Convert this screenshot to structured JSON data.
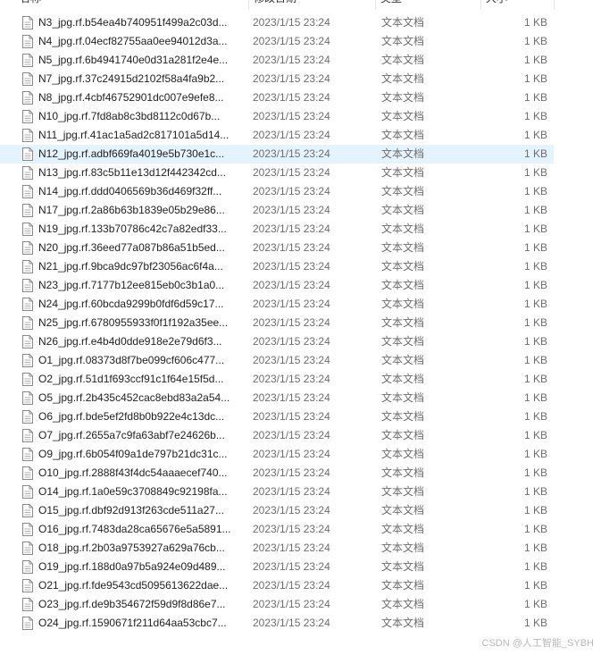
{
  "columns": {
    "name": "名称",
    "modified": "修改日期",
    "type": "类型",
    "size": "大小"
  },
  "icon": "text-document-icon",
  "selected_color": "#e5f3ff",
  "files": [
    {
      "name": "N3_jpg.rf.b54ea4b740951f499a2c03d...",
      "modified": "2023/1/15 23:24",
      "type": "文本文档",
      "size": "1 KB"
    },
    {
      "name": "N4_jpg.rf.04ecf82755aa0ee94012d3a...",
      "modified": "2023/1/15 23:24",
      "type": "文本文档",
      "size": "1 KB"
    },
    {
      "name": "N5_jpg.rf.6b4941740e0d31a281f2e4e...",
      "modified": "2023/1/15 23:24",
      "type": "文本文档",
      "size": "1 KB"
    },
    {
      "name": "N7_jpg.rf.37c24915d2102f58a4fa9b2...",
      "modified": "2023/1/15 23:24",
      "type": "文本文档",
      "size": "1 KB"
    },
    {
      "name": "N8_jpg.rf.4cbf46752901dc007e9efe8...",
      "modified": "2023/1/15 23:24",
      "type": "文本文档",
      "size": "1 KB"
    },
    {
      "name": "N10_jpg.rf.7fd8ab8c3bd8112c0d67b...",
      "modified": "2023/1/15 23:24",
      "type": "文本文档",
      "size": "1 KB"
    },
    {
      "name": "N11_jpg.rf.41ac1a5ad2c817101a5d14...",
      "modified": "2023/1/15 23:24",
      "type": "文本文档",
      "size": "1 KB"
    },
    {
      "name": "N12_jpg.rf.adbf669fa4019e5b730e1c...",
      "modified": "2023/1/15 23:24",
      "type": "文本文档",
      "size": "1 KB",
      "selected": true
    },
    {
      "name": "N13_jpg.rf.83c5b11e13d12f442342cd...",
      "modified": "2023/1/15 23:24",
      "type": "文本文档",
      "size": "1 KB"
    },
    {
      "name": "N14_jpg.rf.ddd0406569b36d469f32ff...",
      "modified": "2023/1/15 23:24",
      "type": "文本文档",
      "size": "1 KB"
    },
    {
      "name": "N17_jpg.rf.2a86b63b1839e05b29e86...",
      "modified": "2023/1/15 23:24",
      "type": "文本文档",
      "size": "1 KB"
    },
    {
      "name": "N19_jpg.rf.133b70786c42c7a82edf33...",
      "modified": "2023/1/15 23:24",
      "type": "文本文档",
      "size": "1 KB"
    },
    {
      "name": "N20_jpg.rf.36eed77a087b86a51b5ed...",
      "modified": "2023/1/15 23:24",
      "type": "文本文档",
      "size": "1 KB"
    },
    {
      "name": "N21_jpg.rf.9bca9dc97bf23056ac6f4a...",
      "modified": "2023/1/15 23:24",
      "type": "文本文档",
      "size": "1 KB"
    },
    {
      "name": "N23_jpg.rf.7177b12ee815eb0c3b1a0...",
      "modified": "2023/1/15 23:24",
      "type": "文本文档",
      "size": "1 KB"
    },
    {
      "name": "N24_jpg.rf.60bcda9299b0fdf6d59c17...",
      "modified": "2023/1/15 23:24",
      "type": "文本文档",
      "size": "1 KB"
    },
    {
      "name": "N25_jpg.rf.6780955933f0f1f192a35ee...",
      "modified": "2023/1/15 23:24",
      "type": "文本文档",
      "size": "1 KB"
    },
    {
      "name": "N26_jpg.rf.e4b4d0dde918e2e79d6f3...",
      "modified": "2023/1/15 23:24",
      "type": "文本文档",
      "size": "1 KB"
    },
    {
      "name": "O1_jpg.rf.08373d8f7be099cf606c477...",
      "modified": "2023/1/15 23:24",
      "type": "文本文档",
      "size": "1 KB"
    },
    {
      "name": "O2_jpg.rf.51d1f693ccf91c1f64e15f5d...",
      "modified": "2023/1/15 23:24",
      "type": "文本文档",
      "size": "1 KB"
    },
    {
      "name": "O5_jpg.rf.2b435c452cac8ebd83a2a54...",
      "modified": "2023/1/15 23:24",
      "type": "文本文档",
      "size": "1 KB"
    },
    {
      "name": "O6_jpg.rf.bde5ef2fd8b0b922e4c13dc...",
      "modified": "2023/1/15 23:24",
      "type": "文本文档",
      "size": "1 KB"
    },
    {
      "name": "O7_jpg.rf.2655a7c9fa63abf7e24626b...",
      "modified": "2023/1/15 23:24",
      "type": "文本文档",
      "size": "1 KB"
    },
    {
      "name": "O9_jpg.rf.6b054f09a1de797b21dc31c...",
      "modified": "2023/1/15 23:24",
      "type": "文本文档",
      "size": "1 KB"
    },
    {
      "name": "O10_jpg.rf.2888f43f4dc54aaaecef740...",
      "modified": "2023/1/15 23:24",
      "type": "文本文档",
      "size": "1 KB"
    },
    {
      "name": "O14_jpg.rf.1a0e59c3708849c92198fa...",
      "modified": "2023/1/15 23:24",
      "type": "文本文档",
      "size": "1 KB"
    },
    {
      "name": "O15_jpg.rf.dbf92d913f263cde511a27...",
      "modified": "2023/1/15 23:24",
      "type": "文本文档",
      "size": "1 KB"
    },
    {
      "name": "O16_jpg.rf.7483da28ca65676e5a5891...",
      "modified": "2023/1/15 23:24",
      "type": "文本文档",
      "size": "1 KB"
    },
    {
      "name": "O18_jpg.rf.2b03a9753927a629a76cb...",
      "modified": "2023/1/15 23:24",
      "type": "文本文档",
      "size": "1 KB"
    },
    {
      "name": "O19_jpg.rf.188d0a97b5a924e09d489...",
      "modified": "2023/1/15 23:24",
      "type": "文本文档",
      "size": "1 KB"
    },
    {
      "name": "O21_jpg.rf.fde9543cd5095613622dae...",
      "modified": "2023/1/15 23:24",
      "type": "文本文档",
      "size": "1 KB"
    },
    {
      "name": "O23_jpg.rf.de9b354672f59d9f8d86e7...",
      "modified": "2023/1/15 23:24",
      "type": "文本文档",
      "size": "1 KB"
    },
    {
      "name": "O24_jpg.rf.1590671f211d64aa53cbc7...",
      "modified": "2023/1/15 23:24",
      "type": "文本文档",
      "size": "1 KB"
    }
  ],
  "watermark": "CSDN @人工智能_SYBH"
}
